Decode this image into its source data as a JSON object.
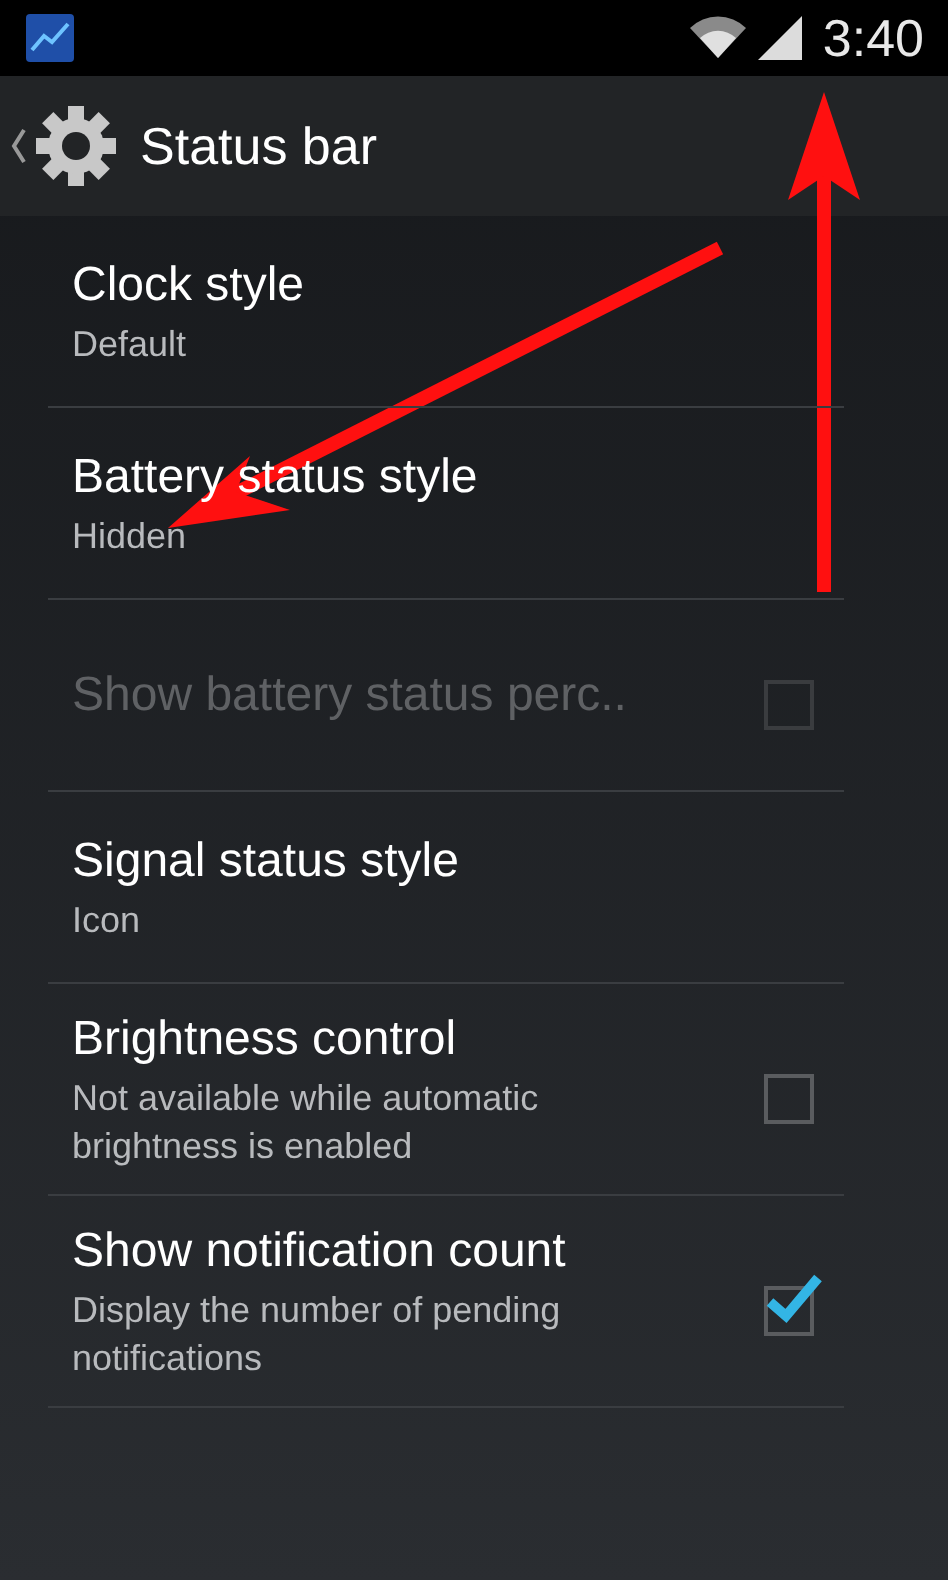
{
  "status_bar": {
    "time": "3:40"
  },
  "action_bar": {
    "title": "Status bar"
  },
  "rows": [
    {
      "kind": "list",
      "title": "Clock style",
      "summary": "Default",
      "disabled": false
    },
    {
      "kind": "list",
      "title": "Battery status style",
      "summary": "Hidden",
      "disabled": false
    },
    {
      "kind": "checkbox",
      "title": "Show battery status perc..",
      "disabled": true,
      "checked": false
    },
    {
      "kind": "list",
      "title": "Signal status style",
      "summary": "Icon",
      "disabled": false
    },
    {
      "kind": "checkbox",
      "title": "Brightness control",
      "summary": "Not available while automatic brightness is enabled",
      "disabled": false,
      "checked": false
    },
    {
      "kind": "checkbox",
      "title": "Show notification count",
      "summary": "Display the number of pending notifications",
      "disabled": false,
      "checked": true
    }
  ]
}
